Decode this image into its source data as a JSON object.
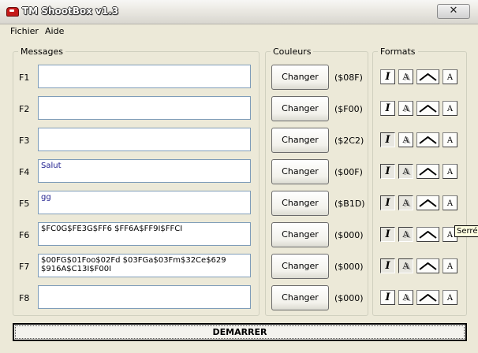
{
  "window": {
    "title": "TM ShootBox v1.3",
    "close_glyph": "✕"
  },
  "menu": [
    "Fichier",
    "Aide"
  ],
  "groups": {
    "messages": "Messages",
    "colors": "Couleurs",
    "formats": "Formats"
  },
  "rows": [
    {
      "label": "F1",
      "text": "",
      "text_color": "",
      "button": "Changer",
      "code": "($08F)",
      "italic_pressed": false,
      "shadow_pressed": false
    },
    {
      "label": "F2",
      "text": "",
      "text_color": "",
      "button": "Changer",
      "code": "($F00)",
      "italic_pressed": false,
      "shadow_pressed": false
    },
    {
      "label": "F3",
      "text": "",
      "text_color": "",
      "button": "Changer",
      "code": "($2C2)",
      "italic_pressed": true,
      "shadow_pressed": false
    },
    {
      "label": "F4",
      "text": "Salut",
      "text_color": "blue",
      "button": "Changer",
      "code": "($00F)",
      "italic_pressed": true,
      "shadow_pressed": true
    },
    {
      "label": "F5",
      "text": "gg",
      "text_color": "blue",
      "button": "Changer",
      "code": "($B1D)",
      "italic_pressed": true,
      "shadow_pressed": true
    },
    {
      "label": "F6",
      "text": "$FC0G$FE3G$FF6 $FF6A$FF9I$FFCI",
      "text_color": "black",
      "button": "Changer",
      "code": "($000)",
      "italic_pressed": true,
      "shadow_pressed": true
    },
    {
      "label": "F7",
      "text": "$00FG$01Foo$02Fd $03FGa$03Fm$32Ce$629\n$916A$C13I$F00I",
      "text_color": "black",
      "button": "Changer",
      "code": "($000)",
      "italic_pressed": true,
      "shadow_pressed": true
    },
    {
      "label": "F8",
      "text": "",
      "text_color": "",
      "button": "Changer",
      "code": "($000)",
      "italic_pressed": false,
      "shadow_pressed": false
    }
  ],
  "format_icons": {
    "italic": "I",
    "shadow": "A",
    "wide": "wide-arc-icon",
    "narrow": "A"
  },
  "tooltip": "Serré",
  "start_button": "DEMARRER"
}
